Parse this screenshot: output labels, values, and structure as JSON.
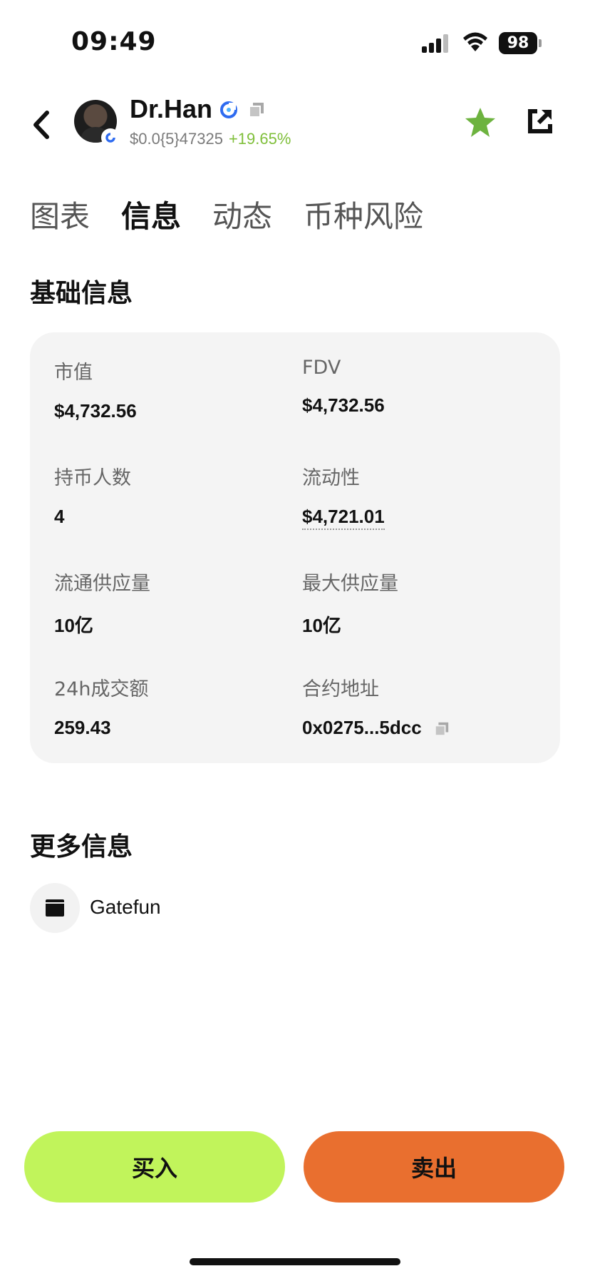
{
  "status_bar": {
    "time": "09:49",
    "battery": "98"
  },
  "header": {
    "token_name": "Dr.Han",
    "price": "$0.0{5}47325",
    "change": "+19.65%",
    "icons": {
      "back": "chevron-left-icon",
      "verified": "verified-badge-icon",
      "copy": "copy-icon",
      "favorite": "star-icon",
      "share": "share-icon"
    },
    "colors": {
      "change": "#7fbf3a",
      "star": "#6db33f"
    }
  },
  "tabs": [
    {
      "label": "图表",
      "active": false
    },
    {
      "label": "信息",
      "active": true
    },
    {
      "label": "动态",
      "active": false
    },
    {
      "label": "币种风险",
      "active": false
    }
  ],
  "basic_info": {
    "title": "基础信息",
    "market_cap": {
      "label": "市值",
      "value": "$4,732.56"
    },
    "fdv": {
      "label": "FDV",
      "value": "$4,732.56"
    },
    "holders": {
      "label": "持币人数",
      "value": "4"
    },
    "liquidity": {
      "label": "流动性",
      "value": "$4,721.01"
    },
    "circulating_supply": {
      "label": "流通供应量",
      "value": "10亿"
    },
    "max_supply": {
      "label": "最大供应量",
      "value": "10亿"
    },
    "volume_24h": {
      "label": "24h成交额",
      "value": "259.43"
    },
    "contract": {
      "label": "合约地址",
      "value": "0x0275...5dcc"
    }
  },
  "more_info": {
    "title": "更多信息",
    "items": [
      {
        "label": "Gatefun",
        "icon": "website-icon"
      }
    ]
  },
  "actions": {
    "buy": "买入",
    "sell": "卖出",
    "buy_color": "#c1f45b",
    "sell_color": "#e96f2f"
  }
}
